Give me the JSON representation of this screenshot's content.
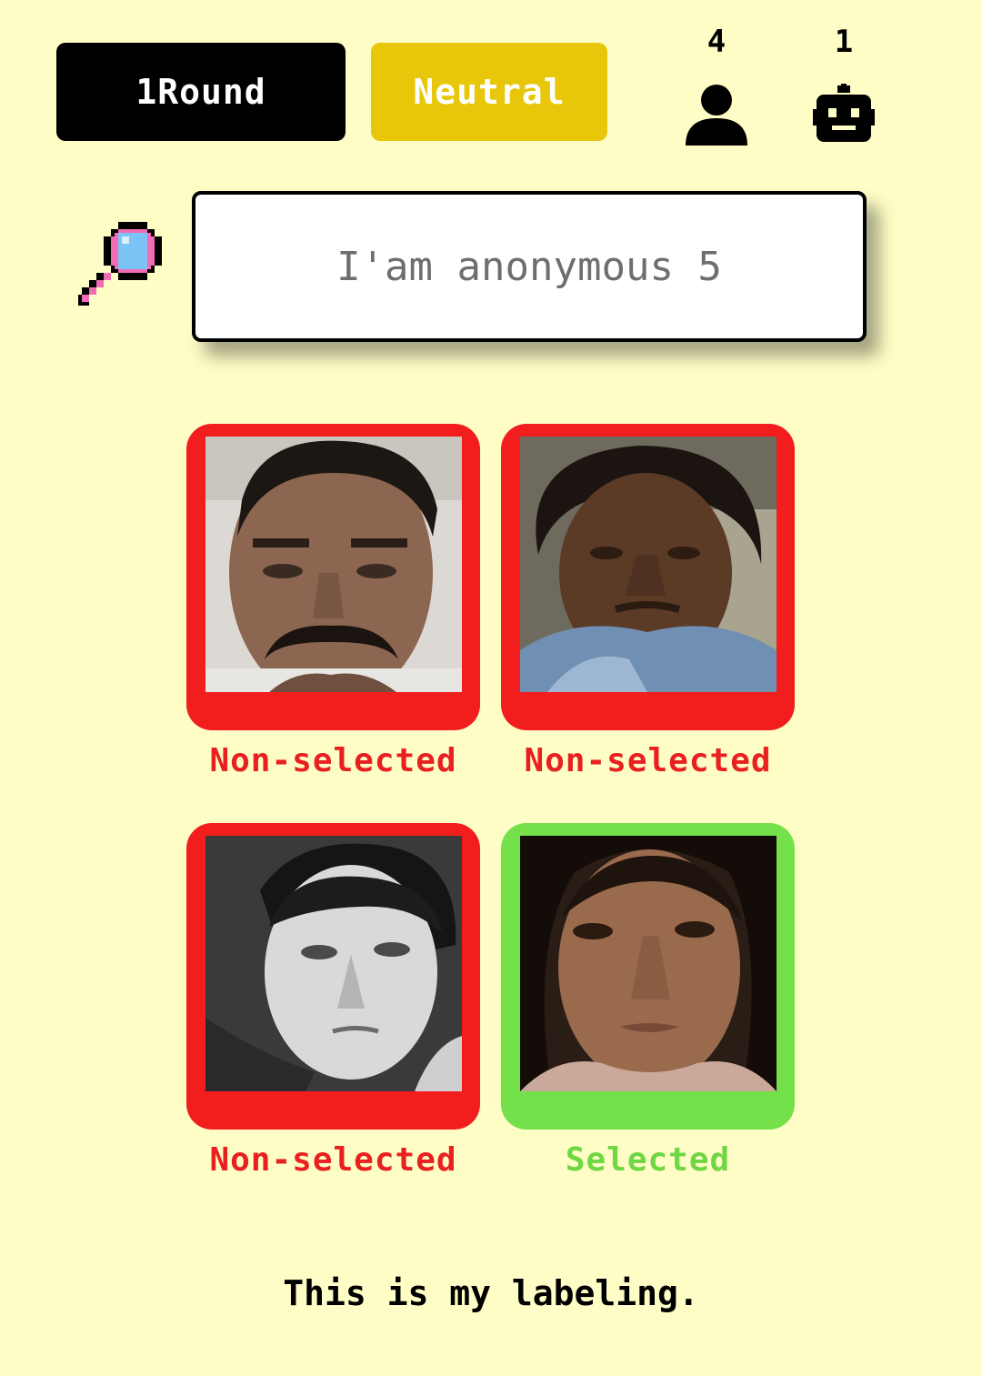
{
  "header": {
    "round_label": "1Round",
    "mood_label": "Neutral",
    "humans_count": "4",
    "bots_count": "1"
  },
  "prompt": {
    "text": "I'am anonymous 5"
  },
  "cards": [
    {
      "status": "Non-selected",
      "state": "red"
    },
    {
      "status": "Non-selected",
      "state": "red"
    },
    {
      "status": "Non-selected",
      "state": "red"
    },
    {
      "status": "Selected",
      "state": "green"
    }
  ],
  "footer": {
    "text": "This is my labeling."
  },
  "colors": {
    "background": "#fefdc6",
    "round_button": "#000000",
    "mood_button": "#e8c60a",
    "non_selected": "#f21e1e",
    "selected": "#74e04a"
  },
  "icons": {
    "humans": "person-icon",
    "bots": "robot-icon",
    "search": "magnifier-icon"
  }
}
